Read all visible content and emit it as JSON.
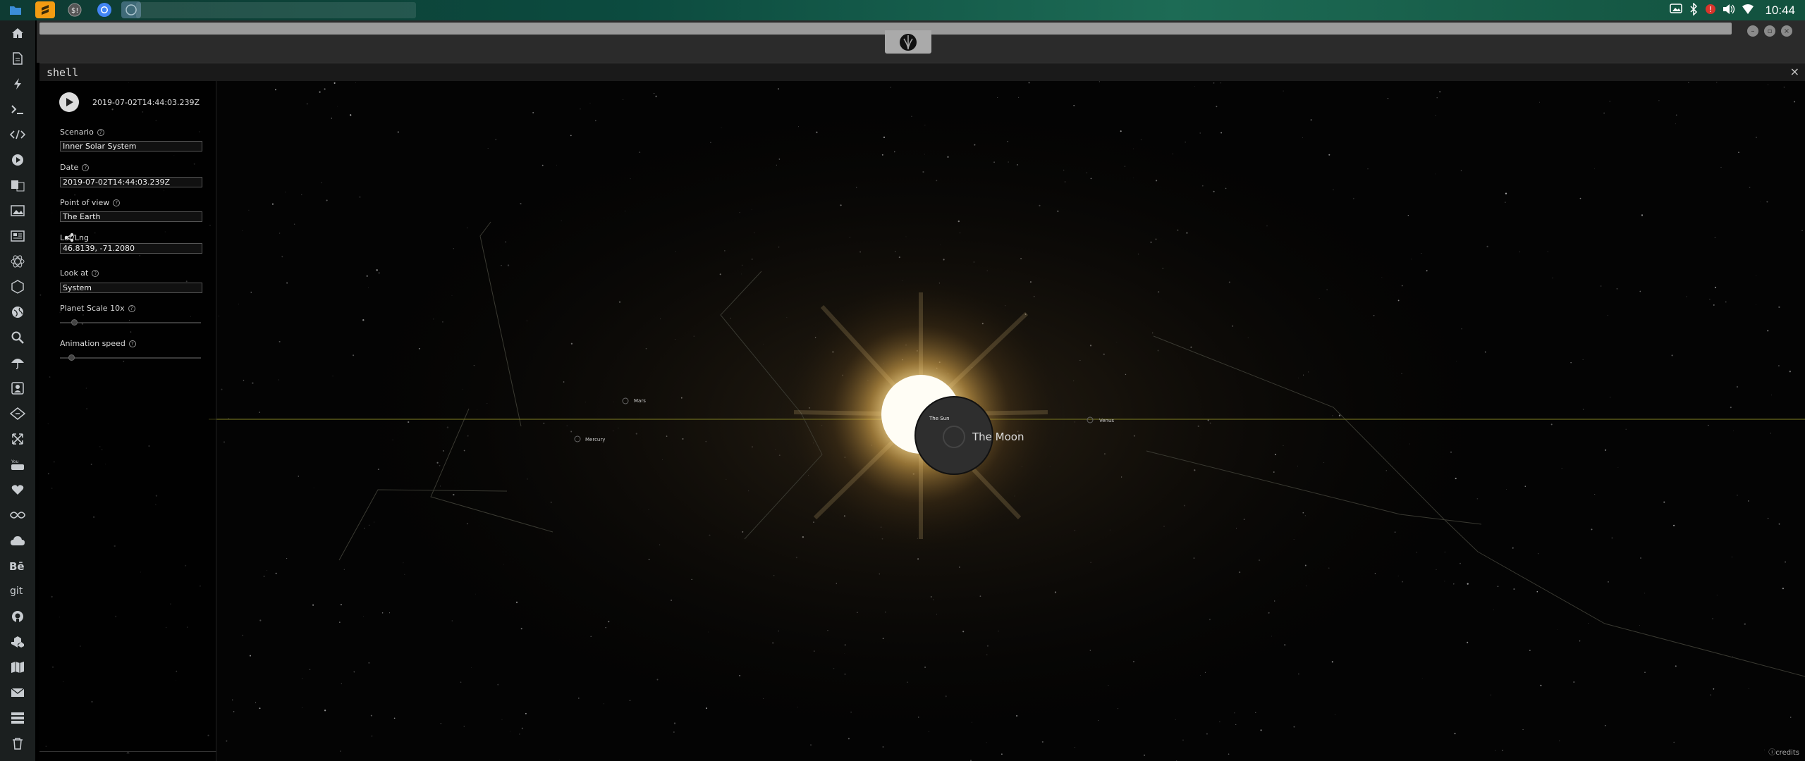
{
  "taskbar": {
    "apps": [
      {
        "name": "files-icon",
        "color": "#3b8ed8"
      },
      {
        "name": "sublime-icon",
        "color": "#f39c12"
      },
      {
        "name": "terminal-icon",
        "color": "#444444"
      },
      {
        "name": "chrome-icon",
        "color": "#4285f4"
      },
      {
        "name": "shell-window-icon",
        "color": "#3f6a78"
      }
    ],
    "clock": "10:44"
  },
  "shell": {
    "title": "shell",
    "close_glyph": "×"
  },
  "controls": {
    "timestamp": "2019-07-02T14:44:03.239Z",
    "scenario_label": "Scenario",
    "scenario_value": "Inner Solar System",
    "date_label": "Date",
    "date_value": "2019-07-02T14:44:03.239Z",
    "pov_label": "Point of view",
    "pov_value": "The Earth",
    "latlng_label": "Lat/Lng",
    "latlng_value": "46.8139, -71.2080",
    "lookat_label": "Look at",
    "lookat_value": "System",
    "planet_scale_label": "Planet Scale 10x",
    "planet_scale_level": 0.1,
    "animation_speed_label": "Animation speed",
    "animation_speed_level": 0.08
  },
  "scene": {
    "bodies": {
      "mars": "Mars",
      "mercury": "Mercury",
      "venus": "Venus",
      "sun": "The Sun"
    },
    "moon_label": "The Moon",
    "credits": "credits",
    "colors": {
      "ecliptic": "#6b6a1f",
      "corona": "#f5c860",
      "moon": "#2e2e2e"
    }
  }
}
